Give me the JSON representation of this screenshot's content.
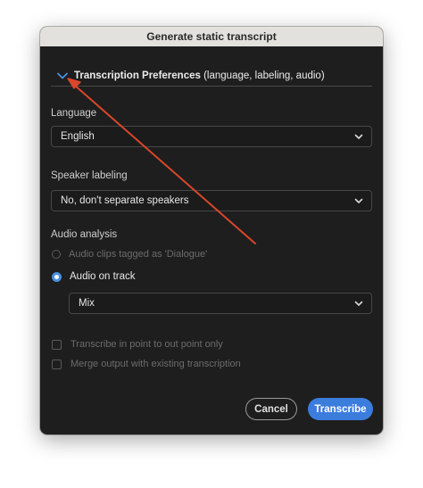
{
  "dialog": {
    "title": "Generate static transcript"
  },
  "section": {
    "title_bold": "Transcription Preferences",
    "title_rest": " (language, labeling, audio)"
  },
  "language": {
    "label": "Language",
    "value": "English"
  },
  "speaker": {
    "label": "Speaker labeling",
    "value": "No, don't separate speakers"
  },
  "audio": {
    "label": "Audio analysis",
    "option_dialogue": "Audio clips tagged as 'Dialogue'",
    "option_track": "Audio on track",
    "track_value": "Mix"
  },
  "checks": {
    "in_out": "Transcribe in point to out point only",
    "merge": "Merge output with existing transcription"
  },
  "buttons": {
    "cancel": "Cancel",
    "primary": "Transcribe"
  },
  "colors": {
    "accent": "#3b7ddd",
    "annotation_arrow": "#d9472b",
    "dialog_bg": "#1e1e1e"
  },
  "icons": {
    "section_toggle": "chevron-down-icon",
    "dropdown": "chevron-down-icon"
  }
}
